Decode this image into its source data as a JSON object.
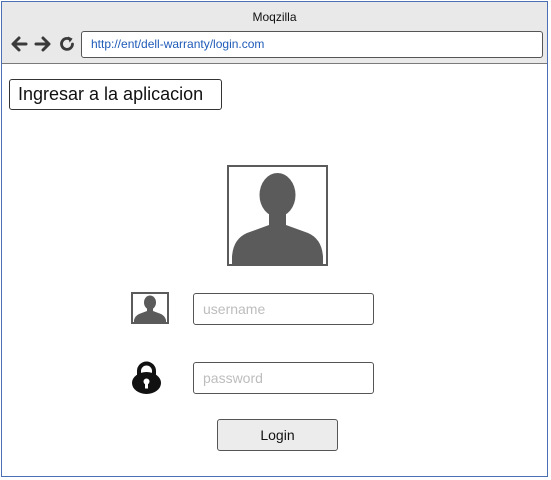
{
  "window": {
    "title": "Moqzilla",
    "url": "http://ent/dell-warranty/login.com"
  },
  "page": {
    "heading": "Ingresar a la aplicacion"
  },
  "form": {
    "username_placeholder": "username",
    "password_placeholder": "password",
    "login_label": "Login"
  },
  "icons": {
    "back": "arrow-left-icon",
    "forward": "arrow-right-icon",
    "reload": "reload-icon",
    "avatar": "user-silhouette-icon",
    "user": "user-icon",
    "lock": "lock-icon"
  },
  "colors": {
    "window_border": "#4a6fb5",
    "url_text": "#1f5bb8",
    "icon_gray": "#5b5b5b",
    "titlebar_bg": "#e9e9e9"
  }
}
